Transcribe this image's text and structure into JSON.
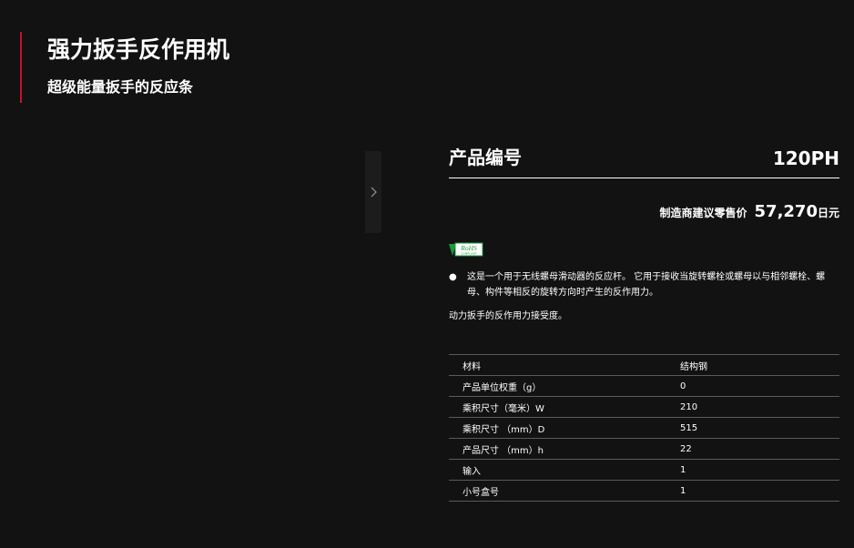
{
  "header": {
    "title": "强力扳手反作用机",
    "subtitle": "超级能量扳手的反应条"
  },
  "gallery": {
    "next_icon": "chevron-right-icon"
  },
  "product": {
    "code_label": "产品编号",
    "code_value": "120PH",
    "price_label": "制造商建议零售价",
    "price_value": "57,270",
    "price_unit": "日元",
    "rohs_mark": "RoHS",
    "rohs_sub": "COMPLIANT",
    "description": "这是一个用于无线螺母滑动器的反应杆。 它用于接收当旋转螺栓或螺母以与相邻螺栓、螺母、构件等相反的旋转方向时产生的反作用力。",
    "note": "动力扳手的反作用力接受度。"
  },
  "specs": [
    {
      "label": "材料",
      "value": "结构钢"
    },
    {
      "label": "产品单位权重（g）",
      "value": "0"
    },
    {
      "label": "乘积尺寸（毫米）W",
      "value": "210"
    },
    {
      "label": "乘积尺寸 （mm）D",
      "value": "515"
    },
    {
      "label": "产品尺寸 （mm）h",
      "value": "22"
    },
    {
      "label": "输入",
      "value": "1"
    },
    {
      "label": "小号盒号",
      "value": "1"
    }
  ],
  "colors": {
    "background": "#121212",
    "accent": "#c8102e",
    "rohs_green": "#1a9a3e"
  }
}
